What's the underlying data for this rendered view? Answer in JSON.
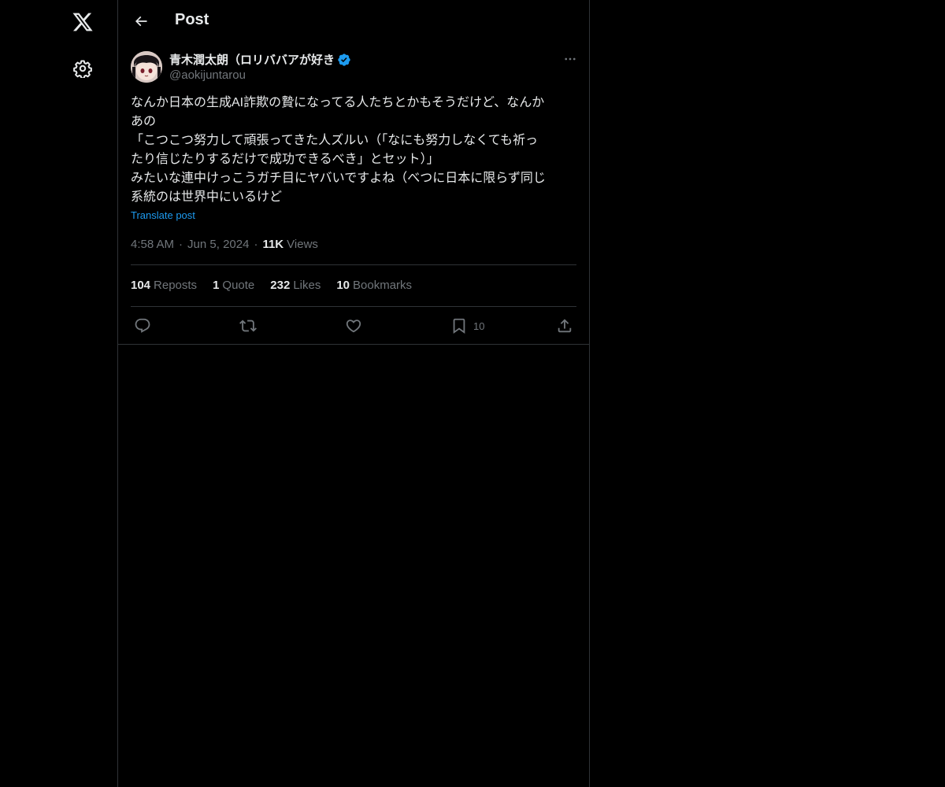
{
  "page": {
    "title": "Post"
  },
  "post": {
    "author": {
      "display_name": "青木潤太朗（ロリババアが好き",
      "handle": "@aokijuntarou"
    },
    "text_lines": [
      "なんか日本の生成AI詐欺の贄になってる人たちとかもそうだけど、なんか",
      "あの",
      "「こつこつ努力して頑張ってきた人ズルい（「なにも努力しなくても祈っ",
      "たり信じたりするだけで成功できるべき」とセット）」",
      "みたいな連中けっこうガチ目にヤバいですよね（べつに日本に限らず同じ",
      "系統のは世界中にいるけど"
    ],
    "translate_label": "Translate post",
    "time": "4:58 AM",
    "date": "Jun 5, 2024",
    "views_count": "11K",
    "views_label": "Views",
    "separator": "·",
    "stats": {
      "reposts": {
        "count": "104",
        "label": "Reposts"
      },
      "quotes": {
        "count": "1",
        "label": "Quote"
      },
      "likes": {
        "count": "232",
        "label": "Likes"
      },
      "bookmarks": {
        "count": "10",
        "label": "Bookmarks"
      }
    },
    "actions": {
      "bookmark_count": "10"
    }
  },
  "icons": [
    "x-logo-icon",
    "settings-gear-icon",
    "back-arrow-icon",
    "verified-badge-icon",
    "more-icon",
    "reply-icon",
    "repost-icon",
    "like-icon",
    "bookmark-icon",
    "share-icon"
  ],
  "colors": {
    "background": "#000000",
    "text": "#e7e9ea",
    "muted": "#71767b",
    "accent": "#1d9bf0",
    "border": "#2f3336"
  }
}
